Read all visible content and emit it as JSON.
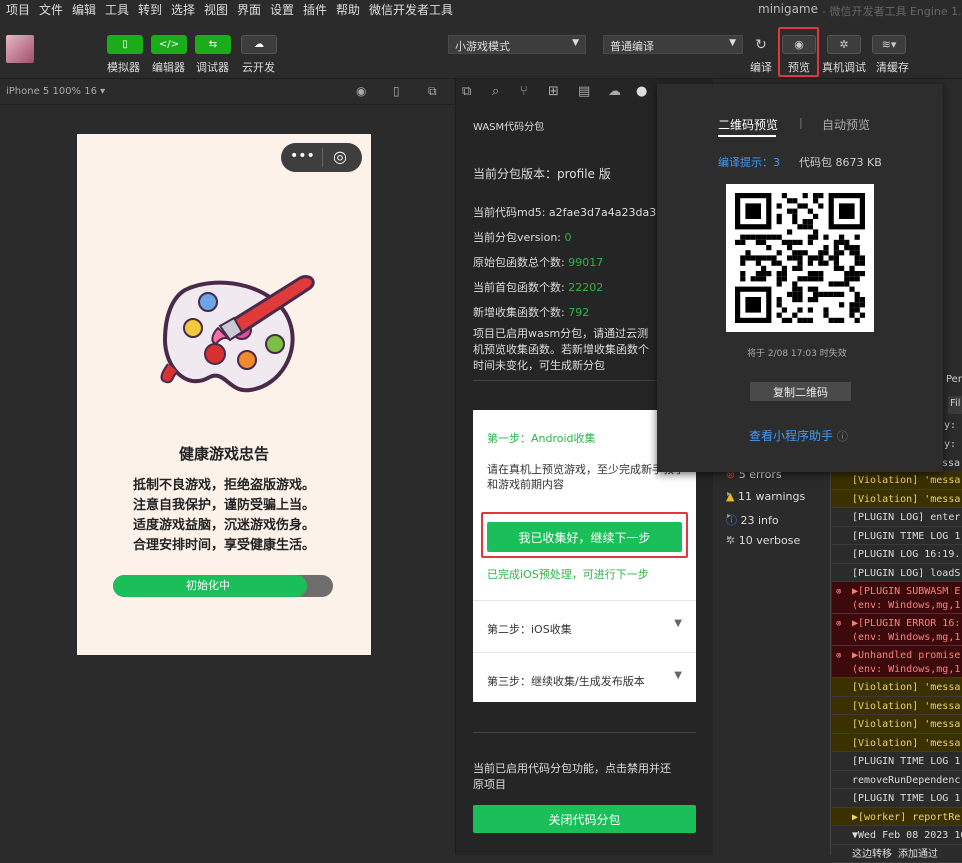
{
  "menu": [
    "项目",
    "文件",
    "编辑",
    "工具",
    "转到",
    "选择",
    "视图",
    "界面",
    "设置",
    "插件",
    "帮助",
    "微信开发者工具"
  ],
  "window_title": "minigame",
  "window_subtitle": "- 微信开发者工具 Engine 1.05.",
  "toolbar": {
    "simulator_label": "模拟器",
    "editor_label": "编辑器",
    "debugger_label": "调试器",
    "cloud_label": "云开发",
    "mode_select": "小游戏模式",
    "compile_select": "普通编译",
    "compile_label": "编译",
    "preview_label": "预览",
    "device_debug_label": "真机调试",
    "clear_cache_label": "清缓存"
  },
  "simulator": {
    "device_label": "iPhone 5 100% 16 ▾",
    "health_title": "健康游戏忠告",
    "health_lines": [
      "抵制不良游戏，拒绝盗版游戏。",
      "注意自我保护，谨防受骗上当。",
      "适度游戏益脑，沉迷游戏伤身。",
      "合理安排时间，享受健康生活。"
    ],
    "progress_text": "初始化中",
    "progress_fraction": 0.88
  },
  "wasm_panel": {
    "title": "WASM代码分包",
    "version_label": "当前分包版本：profile 版",
    "md5_label": "当前代码md5: a2fae3d7a4a23da3",
    "sub_version_label": "当前分包version: ",
    "sub_version_value": "0",
    "orig_func_label": "原始包函数总个数: ",
    "orig_func_value": "99017",
    "first_func_label": "当前首包函数个数: ",
    "first_func_value": "22202",
    "new_func_label": "新增收集函数个数: ",
    "new_func_value": "792",
    "notice": [
      "项目已启用wasm分包，请通过云测",
      "机预览收集函数。若新增收集函数个",
      "时间未变化，可生成新分包"
    ],
    "step1_title": "第一步：Android收集",
    "step1_desc": "请在真机上预览游戏，至少完成新手教学和游戏前期内容",
    "step1_button": "我已收集好，继续下一步",
    "step1_done": "已完成iOS预处理，可进行下一步",
    "step2_title": "第二步：iOS收集",
    "step3_title": "第三步：继续收集/生成发布版本",
    "footer_notice": [
      "当前已启用代码分包功能，点击禁用并还",
      "原项目"
    ],
    "close_button": "关闭代码分包"
  },
  "preview_popup": {
    "tab_qr": "二维码预览",
    "tab_sep": "|",
    "tab_auto": "自动预览",
    "compile_hint_label": "编译提示：",
    "compile_hint_count": "3",
    "package_size": "代码包 8673 KB",
    "expire_text": "将于 2/08 17:03 时失效",
    "copy_button": "复制二维码",
    "helper_link": "查看小程序助手"
  },
  "console": {
    "partial_top": [
      "Per",
      "Fil",
      "y:",
      "y:",
      "essa"
    ],
    "filters": [
      {
        "icon": "error-icon",
        "label": "5 errors",
        "color": "#e0383e"
      },
      {
        "icon": "warning-icon",
        "label": "11 warnings",
        "color": "#e8b923"
      },
      {
        "icon": "info-icon",
        "label": "23 info",
        "color": "#3e82f7"
      },
      {
        "icon": "bug-icon",
        "label": "10 verbose",
        "color": "#aaaaaa"
      }
    ],
    "logs": [
      {
        "type": "warn",
        "text": "[Violation] 'messa"
      },
      {
        "type": "warn",
        "text": "[Violation] 'messa"
      },
      {
        "type": "log",
        "text": "[PLUGIN LOG] enter"
      },
      {
        "type": "log",
        "text": "[PLUGIN TIME LOG 1"
      },
      {
        "type": "log",
        "text": "[PLUGIN LOG 16:19."
      },
      {
        "type": "log",
        "text": "[PLUGIN LOG] loadS"
      },
      {
        "type": "err",
        "text": "▶[PLUGIN SUBWASM E",
        "sub": "(env: Windows,mg,1"
      },
      {
        "type": "err",
        "text": "▶[PLUGIN ERROR 16:",
        "sub": "(env: Windows,mg,1"
      },
      {
        "type": "err",
        "text": "▶Unhandled promise",
        "sub": "(env: Windows,mg,1"
      },
      {
        "type": "warn",
        "text": "[Violation] 'messa"
      },
      {
        "type": "warn",
        "text": "[Violation] 'messa"
      },
      {
        "type": "warn",
        "text": "[Violation] 'messa"
      },
      {
        "type": "warn",
        "text": "[Violation] 'messa"
      },
      {
        "type": "log",
        "text": "[PLUGIN TIME LOG 1"
      },
      {
        "type": "log",
        "text": "removeRunDependenc"
      },
      {
        "type": "log",
        "text": "[PLUGIN TIME LOG 1"
      },
      {
        "type": "warn",
        "text": "▶[worker] reportRe"
      },
      {
        "type": "log",
        "text": "▼Wed Feb 08 2023 16"
      },
      {
        "type": "log",
        "text": "  这边转移 添加通过"
      }
    ]
  },
  "colors": {
    "accent": "#1bbf5a",
    "highlight": "#e0383e",
    "link": "#3e9bf7"
  }
}
